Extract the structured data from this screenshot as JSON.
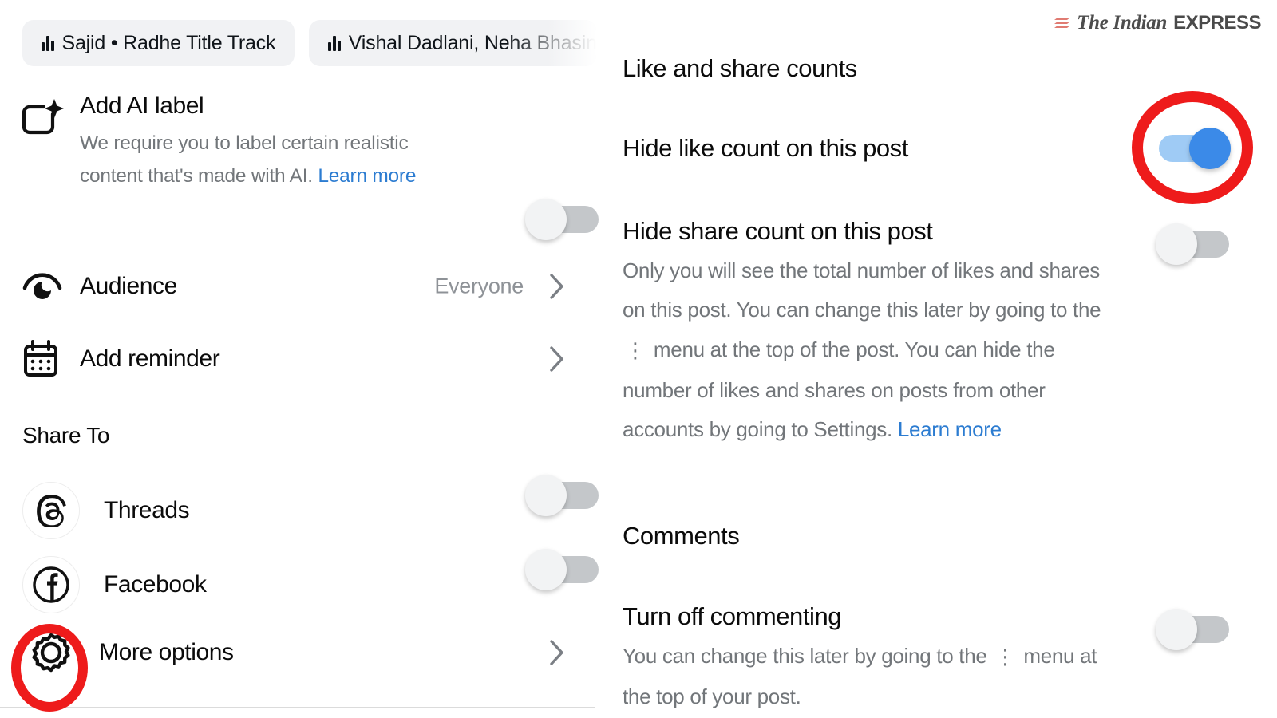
{
  "publisher": {
    "name_italic": "The Indian",
    "name_bold": "EXPRESS",
    "mark": "express-stripes-icon",
    "mark_color": "#e07b72"
  },
  "audio_chips": [
    {
      "icon": "audio-waveform-icon",
      "label": "Sajid • Radhe Title Track"
    },
    {
      "icon": "audio-waveform-icon",
      "label": "Vishal Dadlani, Neha Bhasin,"
    }
  ],
  "left_panel": {
    "ai_label": {
      "icon": "ai-sparkle-icon",
      "title": "Add AI label",
      "description": "We require you to label certain realistic content that's made with AI. ",
      "link_text": "Learn more",
      "toggle_state": "off"
    },
    "audience": {
      "icon": "audience-eye-icon",
      "label": "Audience",
      "value": "Everyone",
      "chevron": "chevron-right-icon"
    },
    "reminder": {
      "icon": "calendar-icon",
      "label": "Add reminder",
      "chevron": "chevron-right-icon"
    },
    "share_to_heading": "Share To",
    "share_items": [
      {
        "icon": "threads-icon",
        "label": "Threads",
        "toggle_state": "off"
      },
      {
        "icon": "facebook-icon",
        "label": "Facebook",
        "toggle_state": "off"
      }
    ],
    "more_options": {
      "icon": "gear-icon",
      "label": "More options",
      "chevron": "chevron-right-icon",
      "highlighted": true
    }
  },
  "right_panel": {
    "like_share_heading": "Like and share counts",
    "hide_like": {
      "title": "Hide like count on this post",
      "toggle_state": "on",
      "highlighted": true
    },
    "hide_share": {
      "title": "Hide share count on this post",
      "description_part1": "Only you will see the total number of likes and shares on this post. You can change this later by going to the ",
      "kebab_glyph": "⋮",
      "description_part2": " menu at the top of the post. You can hide the number of likes and shares on posts from other accounts by going to Settings. ",
      "link_text": "Learn more",
      "toggle_state": "off"
    },
    "comments_heading": "Comments",
    "turn_off_commenting": {
      "title": "Turn off commenting",
      "description_part1": "You can change this later by going to the ",
      "kebab_glyph": "⋮",
      "description_part2": " menu at the top of your post.",
      "toggle_state": "off"
    }
  },
  "colors": {
    "accent_blue": "#3b8ae8",
    "track_blue": "#9fcbf5",
    "link_blue": "#2c7cd1",
    "annotation_red": "#ee1b1b",
    "toggle_off_track": "#c4c7ca",
    "secondary_text": "#72767a",
    "chip_bg": "#f1f2f4"
  }
}
